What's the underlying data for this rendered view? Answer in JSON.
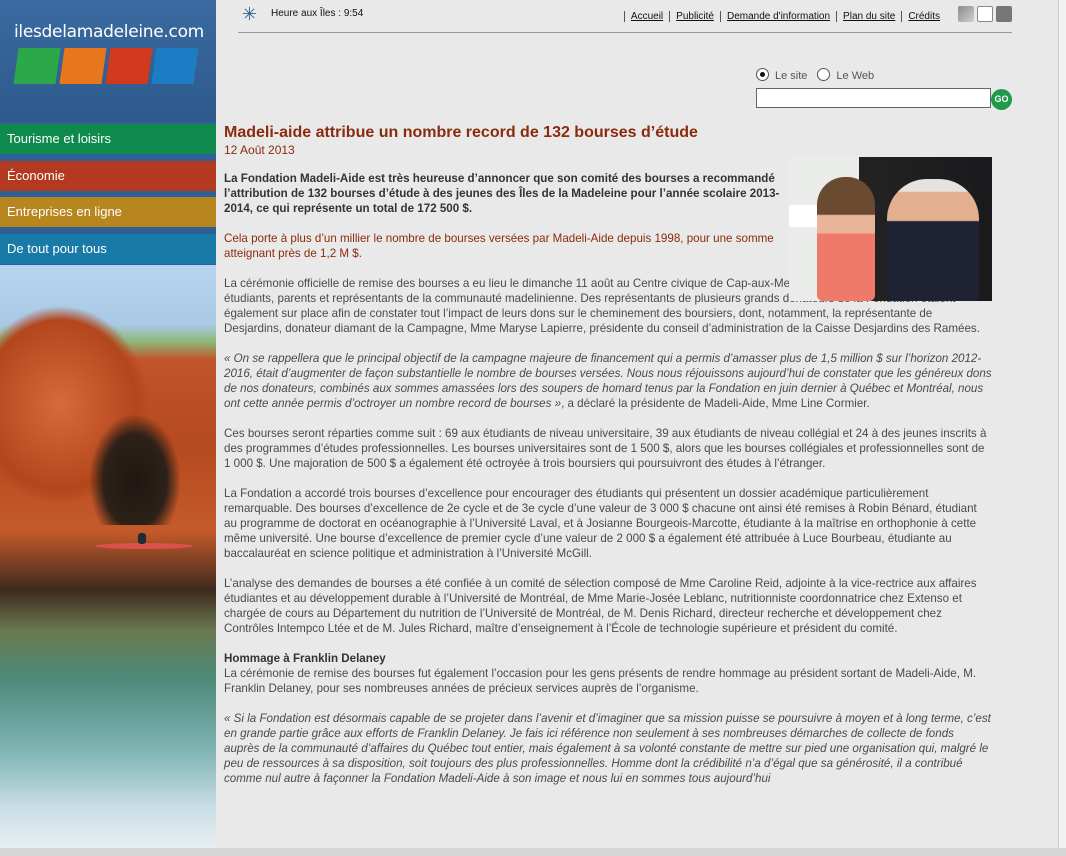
{
  "logo": {
    "text": "ilesdelamadeleine.com"
  },
  "nav": {
    "items": [
      {
        "label": "Tourisme et loisirs",
        "color": "#0e8a4c"
      },
      {
        "label": "Économie",
        "color": "#b33a20"
      },
      {
        "label": "Entreprises en ligne",
        "color": "#b8861e"
      },
      {
        "label": "De tout pour tous",
        "color": "#1a7aa7"
      }
    ]
  },
  "header": {
    "clock": "Heure aux Îles : 9:54",
    "links": [
      "Accueil",
      "Publicité",
      "Demande d'information",
      "Plan du site",
      "Crédits"
    ]
  },
  "search": {
    "option_site": "Le site",
    "option_web": "Le Web",
    "value": "",
    "go": "GO"
  },
  "article": {
    "title": "Madeli-aide attribue un nombre record de 132 bourses d’étude",
    "date": "12 Août 2013",
    "lead": "La Fondation Madeli-Aide est très heureuse d’annoncer que son comité des bourses a recommandé l’attribution de 132 bourses d’étude à des jeunes des Îles de la Madeleine pour l’année scolaire 2013-2014, ce qui représente un total de 172 500 $.",
    "highlight": "Cela porte à plus d’un millier le nombre de bourses versées par Madeli-Aide depuis 1998, pour une somme atteignant près de 1,2 M $.",
    "p1": "La cérémonie officielle de remise des bourses a eu lieu le dimanche 11 août au Centre civique de Cap-aux-Meules en présence de nombreux étudiants, parents et représentants de la communauté madelinienne. Des représentants de plusieurs grands donateurs de la Fondation étaient également sur place afin de constater tout l’impact de leurs dons sur le cheminement des boursiers, dont, notamment, la représentante de Desjardins, donateur diamant de la Campagne, Mme Maryse Lapierre, présidente du conseil d’administration de la Caisse Desjardins des Ramées.",
    "quote1": "« On se rappellera que le principal objectif de la campagne majeure de financement qui a permis d’amasser plus de 1,5 million $ sur l’horizon 2012-2016, était d’augmenter de façon substantielle le nombre de bourses versées. Nous nous réjouissons aujourd’hui de constater que les généreux dons de nos donateurs, combinés aux sommes amassées lors des soupers de homard tenus par la Fondation en juin dernier à Québec et Montréal, nous ont cette année permis d’octroyer un nombre record de bourses »",
    "quote1_tail": ", a déclaré la présidente de Madeli-Aide, Mme Line Cormier.",
    "p2": "Ces bourses seront réparties comme suit : 69 aux étudiants de niveau universitaire, 39 aux étudiants de niveau collégial et 24 à des jeunes inscrits à des programmes d’études professionnelles. Les bourses universitaires sont de 1 500 $, alors que les bourses collégiales et professionnelles sont de 1 000 $. Une majoration de 500 $ a également été octroyée à trois boursiers qui poursuivront des études à l’étranger.",
    "p3": "La Fondation a accordé trois bourses d’excellence pour encourager des étudiants qui présentent un dossier académique particulièrement remarquable. Des bourses d’excellence de 2e cycle et de 3e cycle d’une valeur de 3 000 $ chacune ont ainsi été remises à Robin Bénard, étudiant au programme de doctorat en océanographie à l’Université Laval, et à Josianne Bourgeois-Marcotte, étudiante à la maîtrise en orthophonie à cette même université. Une bourse d’excellence de premier cycle d’une valeur de 2 000 $ a également été attribuée à Luce Bourbeau, étudiante au baccalauréat en science politique et administration à l’Université McGill.",
    "p4": "L’analyse des demandes de bourses a été confiée à un comité de sélection composé de Mme Caroline Reid, adjointe à la vice-rectrice aux affaires étudiantes et au développement durable à l’Université de Montréal, de Mme Marie-Josée Leblanc, nutritionniste coordonnatrice chez Extenso et chargée de cours au Département du nutrition de l’Université de Montréal, de M. Denis Richard, directeur recherche et développement chez Contrôles Intempco Ltée et de M. Jules Richard, maître d’enseignement à l’École de technologie supérieure et président du comité.",
    "subhead": "Hommage à Franklin Delaney",
    "p5": "La cérémonie de remise des bourses fut également l’occasion pour les gens présents de rendre hommage au président sortant de Madeli-Aide, M. Franklin Delaney, pour ses nombreuses années de précieux services auprès de l’organisme.",
    "quote2": "« Si la Fondation est désormais capable de se projeter dans l’avenir et d’imaginer que sa mission puisse se poursuivre à moyen et à long terme, c’est en grande partie grâce aux efforts de Franklin Delaney. Je fais ici référence non seulement à ses nombreuses démarches de collecte de fonds auprès de la communauté d’affaires du Québec tout entier, mais également à sa volonté constante de mettre sur pied une organisation qui, malgré le peu de ressources à sa disposition, soit toujours des plus professionnelles. Homme dont la crédibilité n’a d’égal que sa générosité, il a contribué comme nul autre à façonner la Fondation Madeli-Aide à son image et nous lui en sommes tous aujourd’hui"
  }
}
